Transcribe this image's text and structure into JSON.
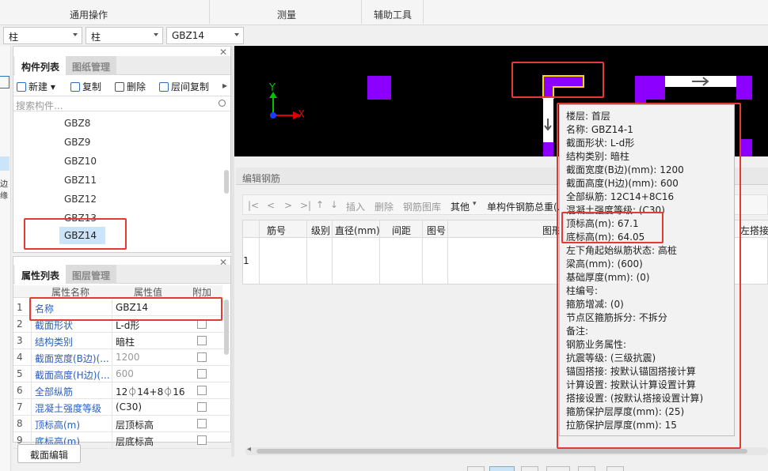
{
  "ribbon": {
    "groups": [
      "通用操作",
      "测量",
      "辅助工具"
    ]
  },
  "selectors": [
    "柱",
    "柱",
    "GBZ14"
  ],
  "component_panel": {
    "tabs": [
      "构件列表",
      "图纸管理"
    ],
    "toolbar": {
      "new": "新建",
      "copy": "复制",
      "delete": "删除",
      "floor_copy": "层间复制"
    },
    "search_placeholder": "搜索构件...",
    "items": [
      "GBZ8",
      "GBZ9",
      "GBZ10",
      "GBZ11",
      "GBZ12",
      "GBZ13",
      "GBZ14"
    ],
    "selected": "GBZ14"
  },
  "property_panel": {
    "tabs": [
      "属性列表",
      "图层管理"
    ],
    "headers": [
      "属性名称",
      "属性值",
      "附加"
    ],
    "rows": [
      {
        "no": "1",
        "name": "名称",
        "value": "GBZ14",
        "check": false
      },
      {
        "no": "2",
        "name": "截面形状",
        "value": "L-d形",
        "check": true
      },
      {
        "no": "3",
        "name": "结构类别",
        "value": "暗柱",
        "check": true
      },
      {
        "no": "4",
        "name": "截面宽度(B边)(...",
        "value": "1200",
        "check": true
      },
      {
        "no": "5",
        "name": "截面高度(H边)(...",
        "value": "600",
        "check": true
      },
      {
        "no": "6",
        "name": "全部纵筋",
        "value": "12⏀14+8⏀16",
        "check": true
      },
      {
        "no": "7",
        "name": "混凝土强度等级",
        "value": "(C30)",
        "check": true
      },
      {
        "no": "8",
        "name": "顶标高(m)",
        "value": "层顶标高",
        "check": true
      },
      {
        "no": "9",
        "name": "底标高(m)",
        "value": "层底标高",
        "check": true
      }
    ],
    "section_edit_button": "截面编辑"
  },
  "left_strip": {
    "label": "边缘"
  },
  "axis": {
    "x": "X",
    "y": "Y"
  },
  "rebar_panel": {
    "title": "编辑钢筋",
    "toolbar": [
      "|<",
      "<",
      ">",
      ">|",
      "↑",
      "↓",
      "插入",
      "删除",
      "钢筋图库",
      "其他",
      "单构件钢筋总重(."
    ],
    "columns": [
      "筋号",
      "级别",
      "直径(mm)",
      "间距",
      "图号",
      "图形",
      "左搭接"
    ],
    "row_no": "1"
  },
  "tooltip": {
    "lines": [
      "楼层: 首层",
      "名称: GBZ14-1",
      "截面形状: L-d形",
      "结构类别: 暗柱",
      "截面宽度(B边)(mm): 1200",
      "截面高度(H边)(mm): 600",
      "全部纵筋: 12C14+8C16",
      "混凝土强度等级: (C30)",
      "顶标高(m): 67.1",
      "底标高(m): 64.05",
      "左下角起始纵筋状态: 高桩",
      "梁高(mm): (600)",
      "基础厚度(mm): (0)",
      "柱编号:",
      "箍筋增减: (0)",
      "节点区箍筋拆分: 不拆分",
      "备注:",
      "钢筋业务属性:",
      "抗震等级: (三级抗震)",
      "锚固搭接: 按默认锚固搭接计算",
      "计算设置: 按默认计算设置计算",
      "搭接设置: (按默认搭接设置计算)",
      "箍筋保护层厚度(mm): (25)",
      "拉筋保护层厚度(mm): 15"
    ]
  },
  "colors": {
    "accent": "#2a6fc6",
    "highlight_red": "#e53935",
    "purple": "#8b00ff",
    "selected_bg": "#cce4f7"
  }
}
